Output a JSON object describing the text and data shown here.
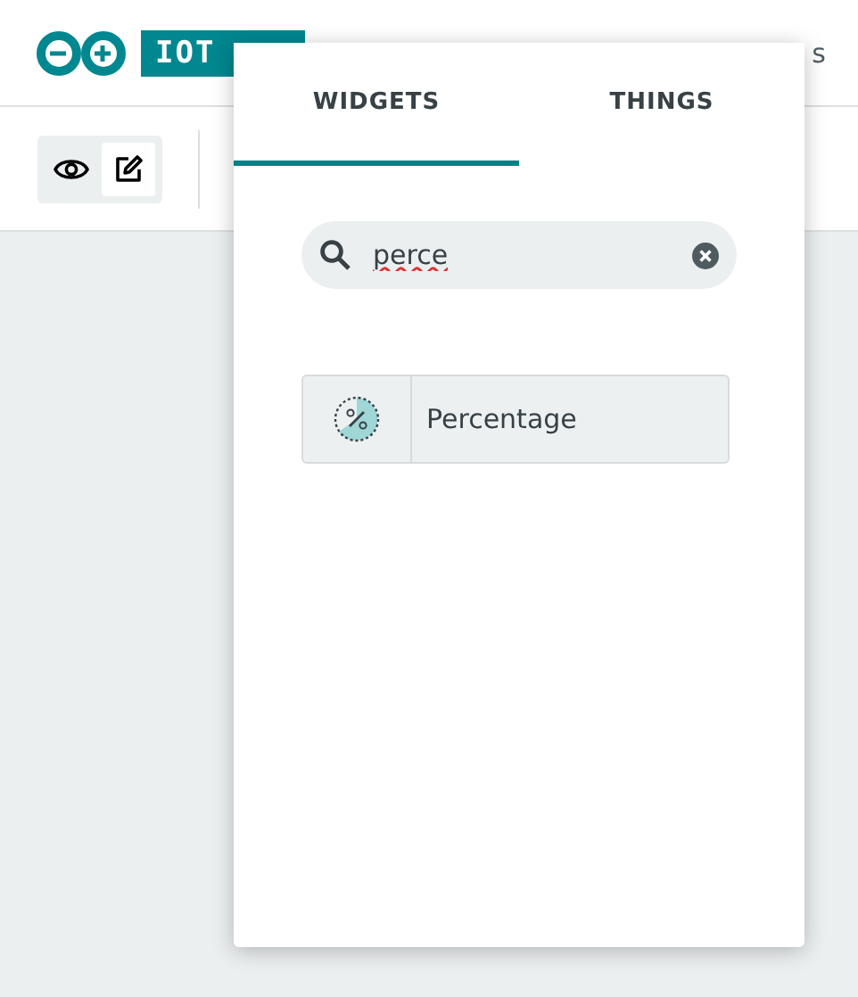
{
  "header": {
    "logo_text": "IOT",
    "nav_fragment": "s"
  },
  "toolbar": {
    "modes": [
      {
        "kind": "view",
        "selected": false
      },
      {
        "kind": "edit",
        "selected": true
      }
    ]
  },
  "popup": {
    "tabs": [
      {
        "label": "WIDGETS",
        "selected": true
      },
      {
        "label": "THINGS",
        "selected": false
      }
    ],
    "search": {
      "value": "perce"
    },
    "results": [
      {
        "label": "Percentage"
      }
    ]
  }
}
